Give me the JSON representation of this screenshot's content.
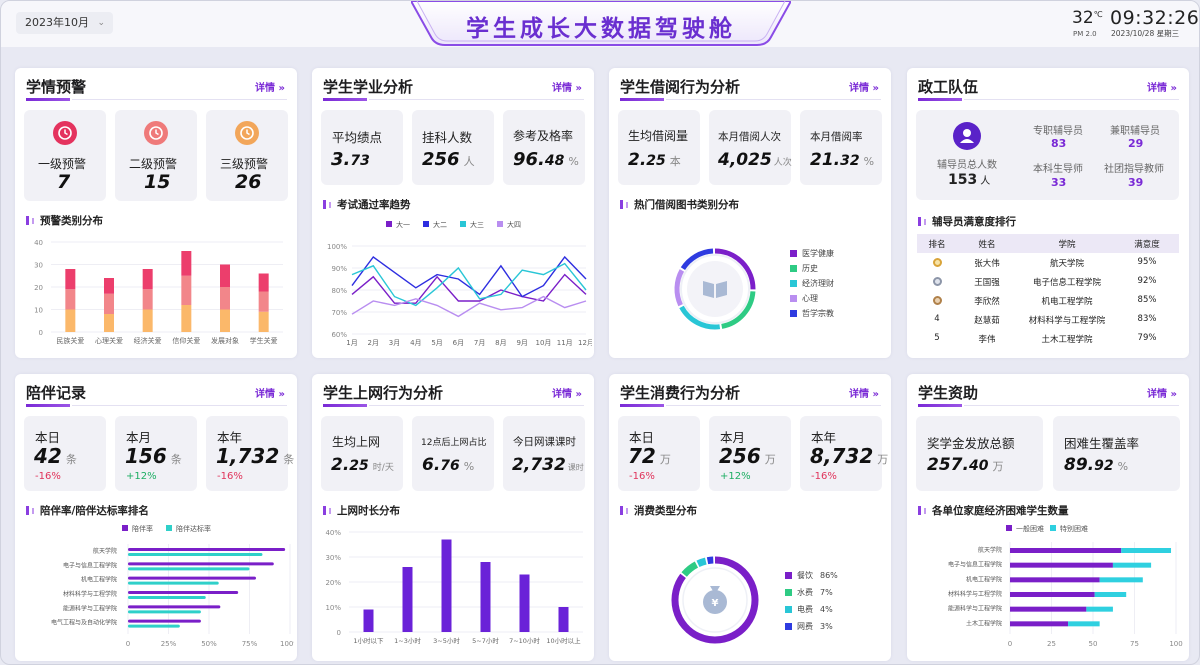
{
  "header": {
    "date_selector": "2023年10月",
    "title": "学生成长大数据驾驶舱",
    "temperature": "32",
    "temp_unit": "℃",
    "pm": "PM 2.0",
    "time": "09:32:26",
    "date": "2023/10/28",
    "weekday": "星期三"
  },
  "more_label": "详情",
  "warning": {
    "title": "学情预警",
    "levels": [
      {
        "label": "一级预警",
        "value": "7",
        "color": "#e4335e"
      },
      {
        "label": "二级预警",
        "value": "15",
        "color": "#ef7a7a"
      },
      {
        "label": "三级预警",
        "value": "26",
        "color": "#f2a65a"
      }
    ],
    "chart_title": "预警类别分布",
    "chart_data": {
      "type": "bar",
      "stacked": true,
      "categories": [
        "民族关爱",
        "心理关爱",
        "经济关爱",
        "信仰关爱",
        "发展对象",
        "学生关爱"
      ],
      "series": [
        {
          "color": "#fbb86a",
          "values": [
            10,
            8,
            10,
            12,
            10,
            9
          ]
        },
        {
          "color": "#f2868a",
          "values": [
            9,
            9,
            9,
            13,
            10,
            9
          ]
        },
        {
          "color": "#ec3e6c",
          "values": [
            9,
            7,
            9,
            11,
            10,
            8
          ]
        }
      ],
      "ylim": [
        0,
        40
      ],
      "yticks": [
        0,
        10,
        20,
        30,
        40
      ]
    }
  },
  "academic": {
    "title": "学生学业分析",
    "stats": [
      {
        "label": "平均绩点",
        "int": "3.",
        "dec": "73",
        "unit": ""
      },
      {
        "label": "挂科人数",
        "int": "256",
        "dec": "",
        "unit": "人"
      },
      {
        "label": "参考及格率",
        "int": "96.",
        "dec": "48",
        "unit": "%"
      }
    ],
    "chart_title": "考试通过率趋势",
    "chart_data": {
      "type": "line",
      "categories": [
        "1月",
        "2月",
        "3月",
        "4月",
        "5月",
        "6月",
        "7月",
        "8月",
        "9月",
        "10月",
        "11月",
        "12月"
      ],
      "series": [
        {
          "name": "大一",
          "color": "#7a1fc8",
          "values": [
            78,
            86,
            74,
            74,
            86,
            75,
            75,
            80,
            77,
            75,
            87,
            78
          ]
        },
        {
          "name": "大二",
          "color": "#2e2ee0",
          "values": [
            82,
            95,
            88,
            81,
            87,
            85,
            78,
            91,
            77,
            82,
            95,
            85
          ]
        },
        {
          "name": "大三",
          "color": "#29c6d6",
          "values": [
            87,
            91,
            77,
            73,
            81,
            90,
            76,
            78,
            89,
            87,
            92,
            80
          ]
        },
        {
          "name": "大四",
          "color": "#b98ef0",
          "values": [
            69,
            75,
            73,
            76,
            73,
            68,
            74,
            71,
            72,
            77,
            72,
            75
          ]
        }
      ],
      "ylim": [
        60,
        100
      ],
      "yticks": [
        "60%",
        "70%",
        "80%",
        "90%",
        "100%"
      ]
    }
  },
  "borrow": {
    "title": "学生借阅行为分析",
    "stats": [
      {
        "label": "生均借阅量",
        "int": "2.",
        "dec": "25",
        "unit": "本"
      },
      {
        "label": "本月借阅人次",
        "int": "4,025",
        "dec": "",
        "unit": "人次"
      },
      {
        "label": "本月借阅率",
        "int": "21.",
        "dec": "32",
        "unit": "%"
      }
    ],
    "chart_title": "热门借阅图书类别分布",
    "chart_data": {
      "type": "pie",
      "labels": [
        "医学健康",
        "历史",
        "经济理财",
        "心理",
        "哲学宗教"
      ],
      "colors": [
        "#7b1fc9",
        "#2ecb84",
        "#29c6d6",
        "#b98ef0",
        "#2e3be0"
      ],
      "values": [
        26,
        22,
        20,
        16,
        16
      ]
    }
  },
  "staff": {
    "title": "政工队伍",
    "total_label": "辅导员总人数",
    "total_value": "153",
    "total_unit": "人",
    "items": [
      {
        "label": "专职辅导员",
        "value": "83"
      },
      {
        "label": "兼职辅导员",
        "value": "29"
      },
      {
        "label": "本科生导师",
        "value": "33"
      },
      {
        "label": "社团指导教师",
        "value": "39"
      }
    ],
    "rank_title": "辅导员满意度排行",
    "table_headers": [
      "排名",
      "姓名",
      "学院",
      "满意度"
    ],
    "rows": [
      {
        "rank": "1",
        "name": "张大伟",
        "college": "航天学院",
        "score": "95%"
      },
      {
        "rank": "2",
        "name": "王国强",
        "college": "电子信息工程学院",
        "score": "92%"
      },
      {
        "rank": "3",
        "name": "李欣然",
        "college": "机电工程学院",
        "score": "85%"
      },
      {
        "rank": "4",
        "name": "赵慧茹",
        "college": "材料科学与工程学院",
        "score": "83%"
      },
      {
        "rank": "5",
        "name": "李伟",
        "college": "土木工程学院",
        "score": "79%"
      }
    ]
  },
  "accompany": {
    "title": "陪伴记录",
    "stats": [
      {
        "label": "本日",
        "value": "42",
        "unit": "条",
        "change": "-16%",
        "dir": "down"
      },
      {
        "label": "本月",
        "value": "156",
        "unit": "条",
        "change": "+12%",
        "dir": "up"
      },
      {
        "label": "本年",
        "value": "1,732",
        "unit": "条",
        "change": "-16%",
        "dir": "down"
      }
    ],
    "chart_title": "陪伴率/陪伴达标率排名",
    "chart_data": {
      "type": "bar",
      "orientation": "horizontal",
      "categories": [
        "航天学院",
        "电子与信息工程学院",
        "机电工程学院",
        "材料科学与工程学院",
        "能源科学与工程学院",
        "电气工程与及自动化学院"
      ],
      "series": [
        {
          "name": "陪伴率",
          "color": "#7a1fc8",
          "values": [
            97,
            90,
            79,
            68,
            57,
            45
          ]
        },
        {
          "name": "陪伴达标率",
          "color": "#2fd0c9",
          "values": [
            83,
            75,
            56,
            48,
            45,
            32
          ]
        }
      ],
      "xlim": [
        0,
        100
      ],
      "xticks": [
        "0",
        "25%",
        "50%",
        "75%",
        "100%"
      ]
    }
  },
  "online": {
    "title": "学生上网行为分析",
    "stats": [
      {
        "label": "生均上网",
        "int": "2.",
        "dec": "25",
        "unit": "时/天"
      },
      {
        "label": "12点后上网占比",
        "int": "6.",
        "dec": "76",
        "unit": "%"
      },
      {
        "label": "今日网课课时",
        "int": "2,732",
        "dec": "",
        "unit": "课时"
      }
    ],
    "chart_title": "上网时长分布",
    "chart_data": {
      "type": "bar",
      "categories": [
        "1小时以下",
        "1~3小时",
        "3~5小时",
        "5~7小时",
        "7~10小时",
        "10小时以上"
      ],
      "values": [
        9,
        26,
        37,
        28,
        23,
        10
      ],
      "ylim": [
        0,
        40
      ],
      "yticks": [
        "0",
        "10%",
        "20%",
        "30%",
        "40%"
      ]
    }
  },
  "consume": {
    "title": "学生消费行为分析",
    "stats": [
      {
        "label": "本日",
        "value": "72",
        "unit": "万",
        "change": "-16%",
        "dir": "down"
      },
      {
        "label": "本月",
        "value": "256",
        "unit": "万",
        "change": "+12%",
        "dir": "up"
      },
      {
        "label": "本年",
        "value": "8,732",
        "unit": "万",
        "change": "-16%",
        "dir": "down"
      }
    ],
    "chart_title": "消费类型分布",
    "chart_data": {
      "type": "pie",
      "labels": [
        "餐饮",
        "水费",
        "电费",
        "网费"
      ],
      "values": [
        86,
        7,
        4,
        3
      ],
      "value_labels": [
        "86%",
        "7%",
        "4%",
        "3%"
      ],
      "colors": [
        "#7a1fc8",
        "#2ecb84",
        "#29c6d6",
        "#2e3be0"
      ]
    }
  },
  "aid": {
    "title": "学生资助",
    "stats": [
      {
        "label": "奖学金发放总额",
        "int": "257.",
        "dec": "40",
        "unit": "万"
      },
      {
        "label": "困难生覆盖率",
        "int": "89.",
        "dec": "92",
        "unit": "%"
      }
    ],
    "chart_title": "各单位家庭经济困难学生数量",
    "chart_data": {
      "type": "bar",
      "orientation": "horizontal",
      "stacked": true,
      "categories": [
        "航天学院",
        "电子与信息工程学院",
        "机电工程学院",
        "材料科学与工程学院",
        "能源科学与工程学院",
        "土木工程学院"
      ],
      "series": [
        {
          "name": "一般困难",
          "color": "#7a1fc8",
          "values": [
            67,
            62,
            54,
            51,
            46,
            35
          ]
        },
        {
          "name": "特别困难",
          "color": "#2fd0e0",
          "values": [
            30,
            23,
            26,
            19,
            16,
            19
          ]
        }
      ],
      "xlim": [
        0,
        100
      ],
      "xticks": [
        "0",
        "25",
        "50",
        "75",
        "100"
      ]
    }
  }
}
